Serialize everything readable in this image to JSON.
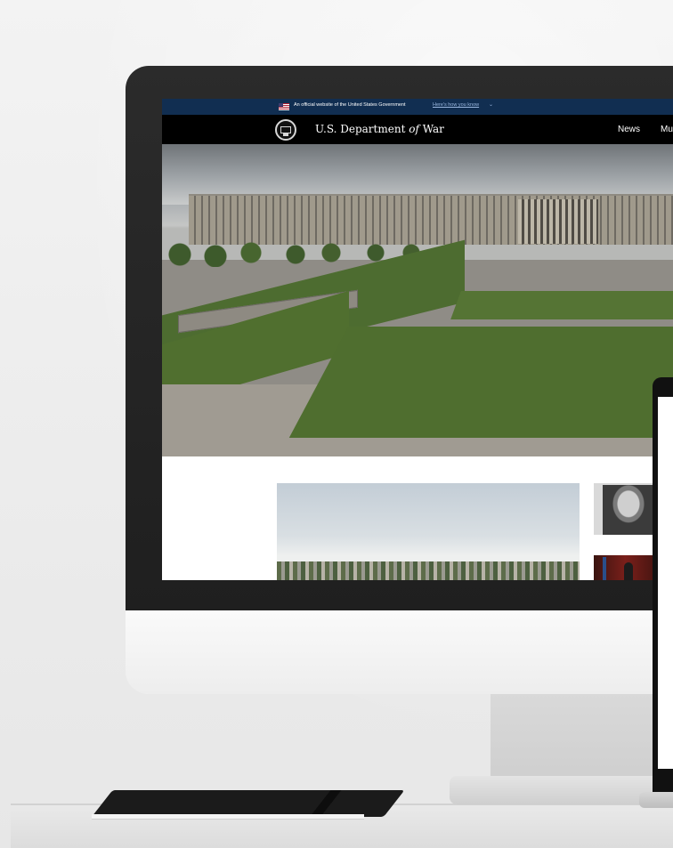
{
  "gov_banner": {
    "text": "An official website of the United States Government",
    "link": "Here's how you know",
    "chevron": "⌄"
  },
  "header": {
    "title_pre": "U.S. Department ",
    "title_of": "of",
    "title_post": " War",
    "nav": [
      "News",
      "Mu"
    ]
  },
  "icons": {
    "flag": "us-flag-icon",
    "seal": "pentagon-seal-icon"
  },
  "colors": {
    "banner_bg": "#112e51",
    "header_bg": "#000000",
    "link": "#9bb8e0"
  }
}
